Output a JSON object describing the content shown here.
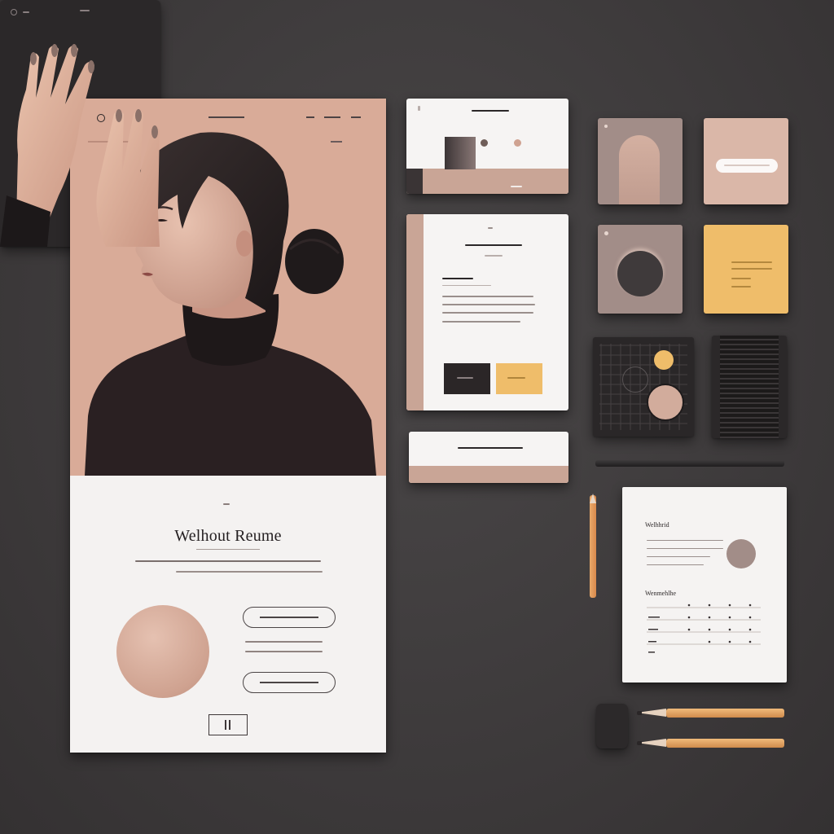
{
  "landing": {
    "title": "Welhout Reume",
    "logo_icon": "circle-logo-icon",
    "hero_image": "woman-portrait-profile",
    "footer_icon": "pause-icon"
  },
  "colors": {
    "background": "#3d3a3b",
    "peach": "#d9ab98",
    "mauve": "#a28d88",
    "mustard": "#efbd6a",
    "paper": "#f4f2f1",
    "dark": "#2b2829"
  },
  "notebook": {
    "heading": "Welhhrid",
    "subheading": "Wenmehlhe"
  }
}
